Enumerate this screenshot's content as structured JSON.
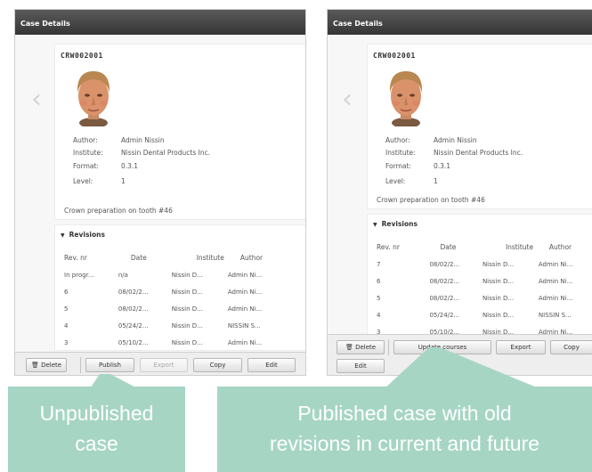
{
  "left_panel": {
    "title": "Case Details",
    "nav_prev_icon": "chevron-left",
    "case": {
      "id": "CRW002001",
      "author_label": "Author:",
      "author": "Admin Nissin",
      "institute_label": "Institute:",
      "institute": "Nissin Dental Products Inc.",
      "format_label": "Format:",
      "format": "0.3.1",
      "level_label": "Level:",
      "level": "1",
      "description": "Crown preparation on tooth #46"
    },
    "revisions": {
      "title": "Revisions",
      "headers": [
        "Rev. nr",
        "Date",
        "Institute",
        "Author"
      ],
      "rows": [
        [
          "In progr...",
          "n/a",
          "Nissin D...",
          "Admin Ni..."
        ],
        [
          "6",
          "08/02/2...",
          "Nissin D...",
          "Admin Ni..."
        ],
        [
          "5",
          "08/02/2...",
          "Nissin D...",
          "Admin Ni..."
        ],
        [
          "4",
          "05/24/2...",
          "Nissin D...",
          "NISSIN S..."
        ],
        [
          "3",
          "05/10/2...",
          "Nissin D...",
          "Admin Ni..."
        ]
      ]
    },
    "toolbar": {
      "delete": "Delete",
      "publish": "Publish",
      "export": "Export",
      "copy": "Copy",
      "edit": "Edit"
    }
  },
  "right_panel": {
    "title": "Case Details",
    "nav_prev_icon": "chevron-left",
    "case": {
      "id": "CRW002001",
      "author_label": "Author:",
      "author": "Admin Nissin",
      "institute_label": "Institute:",
      "institute": "Nissin Dental Products Inc.",
      "format_label": "Format:",
      "format": "0.3.1",
      "level_label": "Level:",
      "level": "1",
      "description": "Crown preparation on tooth #46"
    },
    "revisions": {
      "title": "Revisions",
      "headers": [
        "Rev. nr",
        "Date",
        "Institute",
        "Author"
      ],
      "rows": [
        [
          "7",
          "08/02/2...",
          "Nissin D...",
          "Admin Ni..."
        ],
        [
          "6",
          "08/02/2...",
          "Nissin D...",
          "Admin Ni..."
        ],
        [
          "5",
          "08/02/2...",
          "Nissin D...",
          "Admin Ni..."
        ],
        [
          "4",
          "05/24/2...",
          "Nissin D...",
          "NISSIN S..."
        ],
        [
          "3",
          "05/10/2...",
          "Nissin D...",
          "Admin Ni..."
        ]
      ]
    },
    "toolbar": {
      "delete": "Delete",
      "update_courses": "Update courses",
      "export": "Export",
      "copy": "Copy",
      "edit": "Edit"
    }
  },
  "callouts": {
    "left_line1": "Unpublished",
    "left_line2": "case",
    "right_line1": "Published case with old",
    "right_line2": "revisions in current and future"
  },
  "colors": {
    "callout_bg": "#a6d5c4",
    "titlebar": "#3f3f3f"
  }
}
